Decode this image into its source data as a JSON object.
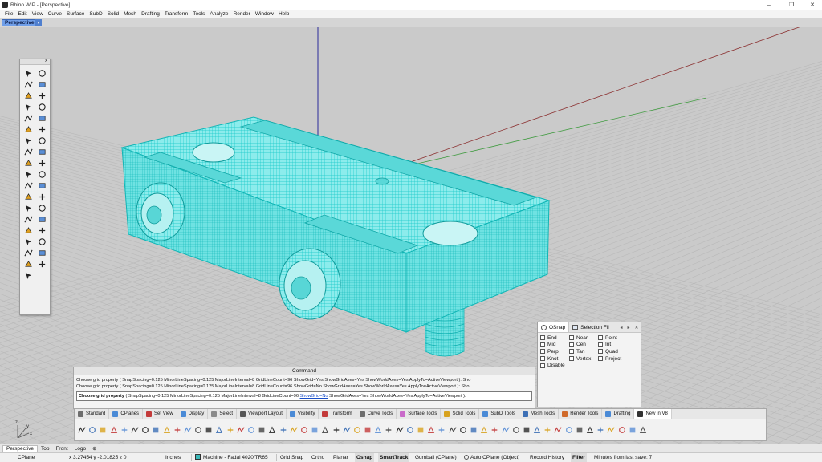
{
  "window": {
    "title": "Rhino WIP - [Perspective]",
    "controls": [
      "–",
      "❐",
      "✕"
    ]
  },
  "menu": [
    "File",
    "Edit",
    "View",
    "Curve",
    "Surface",
    "SubD",
    "Solid",
    "Mesh",
    "Drafting",
    "Transform",
    "Tools",
    "Analyze",
    "Render",
    "Window",
    "Help"
  ],
  "viewport": {
    "active_tab": "Perspective",
    "tab_arrow": "▾",
    "axis_labels": {
      "x": "x",
      "y": "y",
      "z": "z"
    },
    "colors": {
      "background": "#cacaca",
      "grid": "#b9b9b9",
      "mesh": "#1fd6d6",
      "mesh_fill": "#7fe8e8",
      "x_axis": "#8b3030",
      "y_axis": "#3e9a3e",
      "z_axis": "#2a2a9a"
    }
  },
  "floating_toolbar": {
    "close": "x",
    "icons": [
      "select-arrow-icon",
      "point-icon",
      "polyline-icon",
      "curve-icon",
      "circle-icon",
      "arc-icon",
      "rectangle-icon",
      "polygon-icon",
      "freeform-curve-icon",
      "ellipse-icon",
      "fillet-curve-icon",
      "offset-curve-icon",
      "surface-icon",
      "edit-surface-icon",
      "box-icon",
      "solid-edit-icon",
      "mesh-icon",
      "mesh-edit-icon",
      "explode-icon",
      "trim-icon",
      "move-icon",
      "copy-icon",
      "boolean-icon",
      "array-icon",
      "join-icon",
      "rotate-icon",
      "text-icon",
      "dimension-icon",
      "block-icon",
      "layer-icon",
      "cube-icon",
      "render-icon",
      "snap-icon",
      "history-icon",
      "check-icon",
      "analyze-icon",
      "paint-icon"
    ]
  },
  "osnap": {
    "tabs": [
      "OSnap",
      "Selection Fil"
    ],
    "controls": [
      "◂",
      "▸",
      "✕"
    ],
    "options": [
      {
        "label": "End",
        "checked": false
      },
      {
        "label": "Near",
        "checked": false
      },
      {
        "label": "Point",
        "checked": false
      },
      {
        "label": "Mid",
        "checked": false
      },
      {
        "label": "Cen",
        "checked": false
      },
      {
        "label": "Int",
        "checked": false
      },
      {
        "label": "Perp",
        "checked": false
      },
      {
        "label": "Tan",
        "checked": false
      },
      {
        "label": "Quad",
        "checked": false
      },
      {
        "label": "Knot",
        "checked": false
      },
      {
        "label": "Vertex",
        "checked": false
      },
      {
        "label": "Project",
        "checked": false
      },
      {
        "label": "Disable",
        "checked": false
      }
    ]
  },
  "command": {
    "title": "Command",
    "history": [
      "Choose grid property ( SnapSpacing=0.125  MinorLineSpacing=0.125  MajorLineInterval=8  GridLineCount=96  ShowGrid=Yes  ShowGridAxes=Yes  ShowWorldAxes=Yes  ApplyTo=ActiveViewport ): Sho",
      "Choose grid property ( SnapSpacing=0.125  MinorLineSpacing=0.125  MajorLineInterval=8  GridLineCount=96  ShowGrid=No  ShowGridAxes=Yes  ShowWorldAxes=Yes  ApplyTo=ActiveViewport ): Sho"
    ],
    "prompt_lead": "Choose grid property",
    "prompt_options": "( SnapSpacing=0.125  MinorLineSpacing=0.125  MajorLineInterval=8  GridLineCount=96 ",
    "prompt_link": "ShowGrid=No",
    "prompt_tail": "  ShowGridAxes=Yes  ShowWorldAxes=Yes  ApplyTo=ActiveViewport ):"
  },
  "toolbar_tabs": [
    {
      "label": "Standard",
      "color": "#6d6d6d"
    },
    {
      "label": "CPlanes",
      "color": "#4a8ad6"
    },
    {
      "label": "Set View",
      "color": "#c33a3a"
    },
    {
      "label": "Display",
      "color": "#4a8ad6"
    },
    {
      "label": "Select",
      "color": "#8a8a8a"
    },
    {
      "label": "Viewport Layout",
      "color": "#555555"
    },
    {
      "label": "Visibility",
      "color": "#4a8ad6"
    },
    {
      "label": "Transform",
      "color": "#c33a3a"
    },
    {
      "label": "Curve Tools",
      "color": "#6d6d6d"
    },
    {
      "label": "Surface Tools",
      "color": "#c96ac9"
    },
    {
      "label": "Solid Tools",
      "color": "#d8a21e"
    },
    {
      "label": "SubD Tools",
      "color": "#4a8ad6"
    },
    {
      "label": "Mesh Tools",
      "color": "#3c6fb5"
    },
    {
      "label": "Render Tools",
      "color": "#d06a2a"
    },
    {
      "label": "Drafting",
      "color": "#4a8ad6"
    },
    {
      "label": "New in V8",
      "color": "#333333"
    }
  ],
  "toolbar_icon_count": 54,
  "bottom_tabs": [
    "Perspective",
    "Top",
    "Front",
    "Logo",
    "⊕"
  ],
  "status": {
    "cplane": "CPlane",
    "coords": "x 3.27454  y -2.01825  z 0",
    "units": "Inches",
    "layer": "Machine - Fadal 4020/TR65",
    "layer_color": "#3ab8b8",
    "grid_snap": "Grid Snap",
    "ortho": "Ortho",
    "planar": "Planar",
    "osnap": "Osnap",
    "smarttrack": "SmartTrack",
    "gumball": "Gumball (CPlane)",
    "autocplane": "Auto CPlane (Object)",
    "history": "Record History",
    "filter": "Filter",
    "save": "Minutes from last save: 7"
  }
}
